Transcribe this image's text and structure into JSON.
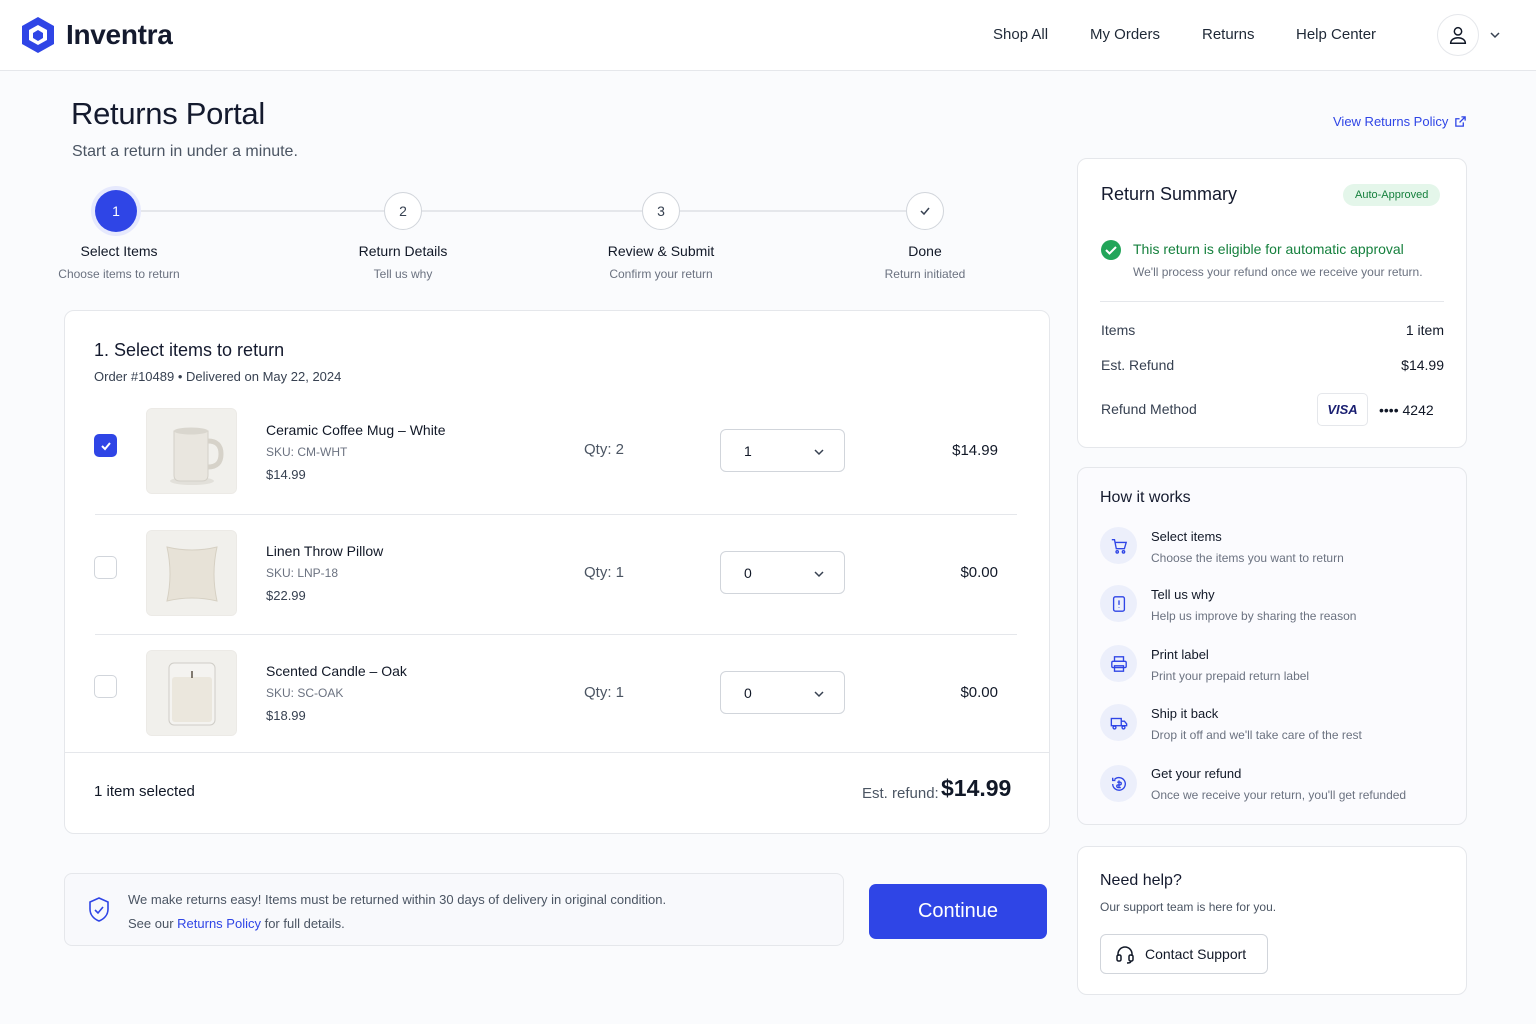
{
  "brand": {
    "name": "Inventra",
    "accent": "#2f45e6"
  },
  "nav": {
    "items": [
      "Shop All",
      "My Orders",
      "Returns",
      "Help Center"
    ]
  },
  "page": {
    "title": "Returns Portal",
    "subtitle": "Start a return in under a minute.",
    "policy_link": "View Returns Policy"
  },
  "stepper": {
    "steps": [
      {
        "number": "1",
        "label": "Select Items",
        "sub": "Choose items to return",
        "state": "active"
      },
      {
        "number": "2",
        "label": "Return Details",
        "sub": "Tell us why",
        "state": "upcoming"
      },
      {
        "number": "3",
        "label": "Review & Submit",
        "sub": "Confirm your return",
        "state": "upcoming"
      },
      {
        "number": "",
        "label": "Done",
        "sub": "Return initiated",
        "state": "done-icon"
      }
    ]
  },
  "selection": {
    "title": "1. Select items to return",
    "order_meta": "Order #10489 • Delivered on May 22, 2024",
    "items": [
      {
        "name": "Ceramic Coffee Mug – White",
        "sku": "SKU: CM-WHT",
        "price": "$14.99",
        "qty": "Qty: 2",
        "selected_qty": "1",
        "amount": "$14.99",
        "checked": true
      },
      {
        "name": "Linen Throw Pillow",
        "sku": "SKU: LNP-18",
        "price": "$22.99",
        "qty": "Qty: 1",
        "selected_qty": "0",
        "amount": "$0.00",
        "checked": false
      },
      {
        "name": "Scented Candle – Oak",
        "sku": "SKU: SC-OAK",
        "price": "$18.99",
        "qty": "Qty: 1",
        "selected_qty": "0",
        "amount": "$0.00",
        "checked": false
      }
    ],
    "selected_count": "1 item selected",
    "est_label": "Est. refund:",
    "est_value": "$14.99"
  },
  "notice": {
    "line1": "We make returns easy! Items must be returned within 30 days of delivery in original condition.",
    "line2_before": "See our ",
    "line2_link": "Returns Policy",
    "line2_after": " for full details."
  },
  "continue_label": "Continue",
  "summary": {
    "title": "Return Summary",
    "badge": "Auto-Approved",
    "eligible_title": "This return is eligible for automatic approval",
    "eligible_sub": "We'll process your refund once we receive your return.",
    "items_label": "Items",
    "items_value": "1 item",
    "refund_label": "Est. Refund",
    "refund_value": "$14.99",
    "method_label": "Refund Method",
    "card_brand": "VISA",
    "card_number": "•••• 4242"
  },
  "how": {
    "title": "How it works",
    "steps": [
      {
        "icon": "cart-icon",
        "title": "Select items",
        "desc": "Choose the items you want to return"
      },
      {
        "icon": "document-icon",
        "title": "Tell us why",
        "desc": "Help us improve by sharing the reason"
      },
      {
        "icon": "printer-icon",
        "title": "Print label",
        "desc": "Print your prepaid return label"
      },
      {
        "icon": "truck-icon",
        "title": "Ship it back",
        "desc": "Drop it off and we'll take care of the rest"
      },
      {
        "icon": "refund-icon",
        "title": "Get your refund",
        "desc": "Once we receive your return, you'll get refunded"
      }
    ]
  },
  "help": {
    "title": "Need help?",
    "sub": "Our support team is here for you.",
    "button": "Contact Support"
  }
}
